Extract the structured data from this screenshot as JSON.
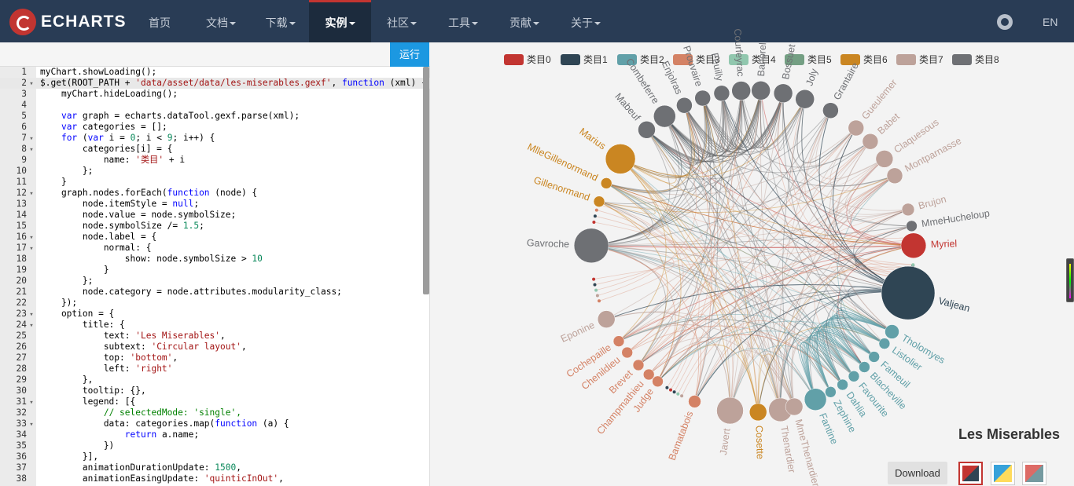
{
  "nav": {
    "logo_text": "ECHARTS",
    "items": [
      {
        "label": "首页",
        "caret": false
      },
      {
        "label": "文档",
        "caret": true
      },
      {
        "label": "下载",
        "caret": true
      },
      {
        "label": "实例",
        "caret": true,
        "active": true
      },
      {
        "label": "社区",
        "caret": true
      },
      {
        "label": "工具",
        "caret": true
      },
      {
        "label": "贡献",
        "caret": true
      },
      {
        "label": "关于",
        "caret": true
      }
    ],
    "lang": "EN"
  },
  "editor": {
    "run_label": "运行",
    "lines": [
      {
        "n": "1",
        "fold": "",
        "code": "myChart.showLoading();"
      },
      {
        "n": "2",
        "fold": "▾",
        "code": "$.get(ROOT_PATH + 'data/asset/data/les-miserables.gexf', function (xml) {"
      },
      {
        "n": "3",
        "fold": "",
        "code": "    myChart.hideLoading();"
      },
      {
        "n": "4",
        "fold": "",
        "code": ""
      },
      {
        "n": "5",
        "fold": "",
        "code": "    var graph = echarts.dataTool.gexf.parse(xml);"
      },
      {
        "n": "6",
        "fold": "",
        "code": "    var categories = [];"
      },
      {
        "n": "7",
        "fold": "▾",
        "code": "    for (var i = 0; i < 9; i++) {"
      },
      {
        "n": "8",
        "fold": "▾",
        "code": "        categories[i] = {"
      },
      {
        "n": "9",
        "fold": "",
        "code": "            name: '类目' + i"
      },
      {
        "n": "10",
        "fold": "",
        "code": "        };"
      },
      {
        "n": "11",
        "fold": "",
        "code": "    }"
      },
      {
        "n": "12",
        "fold": "▾",
        "code": "    graph.nodes.forEach(function (node) {"
      },
      {
        "n": "13",
        "fold": "",
        "code": "        node.itemStyle = null;"
      },
      {
        "n": "14",
        "fold": "",
        "code": "        node.value = node.symbolSize;"
      },
      {
        "n": "15",
        "fold": "",
        "code": "        node.symbolSize /= 1.5;"
      },
      {
        "n": "16",
        "fold": "▾",
        "code": "        node.label = {"
      },
      {
        "n": "17",
        "fold": "▾",
        "code": "            normal: {"
      },
      {
        "n": "18",
        "fold": "",
        "code": "                show: node.symbolSize > 10"
      },
      {
        "n": "19",
        "fold": "",
        "code": "            }"
      },
      {
        "n": "20",
        "fold": "",
        "code": "        };"
      },
      {
        "n": "21",
        "fold": "",
        "code": "        node.category = node.attributes.modularity_class;"
      },
      {
        "n": "22",
        "fold": "",
        "code": "    });"
      },
      {
        "n": "23",
        "fold": "▾",
        "code": "    option = {"
      },
      {
        "n": "24",
        "fold": "▾",
        "code": "        title: {"
      },
      {
        "n": "25",
        "fold": "",
        "code": "            text: 'Les Miserables',"
      },
      {
        "n": "26",
        "fold": "",
        "code": "            subtext: 'Circular layout',"
      },
      {
        "n": "27",
        "fold": "",
        "code": "            top: 'bottom',"
      },
      {
        "n": "28",
        "fold": "",
        "code": "            left: 'right'"
      },
      {
        "n": "29",
        "fold": "",
        "code": "        },"
      },
      {
        "n": "30",
        "fold": "",
        "code": "        tooltip: {},"
      },
      {
        "n": "31",
        "fold": "▾",
        "code": "        legend: [{"
      },
      {
        "n": "32",
        "fold": "",
        "code": "            // selectedMode: 'single',"
      },
      {
        "n": "33",
        "fold": "▾",
        "code": "            data: categories.map(function (a) {"
      },
      {
        "n": "34",
        "fold": "",
        "code": "                return a.name;"
      },
      {
        "n": "35",
        "fold": "",
        "code": "            })"
      },
      {
        "n": "36",
        "fold": "",
        "code": "        }],"
      },
      {
        "n": "37",
        "fold": "",
        "code": "        animationDurationUpdate: 1500,"
      },
      {
        "n": "38",
        "fold": "",
        "code": "        animationEasingUpdate: 'quinticInOut',"
      }
    ]
  },
  "chart": {
    "title": "Les Miserables",
    "download_label": "Download",
    "legend": [
      {
        "name": "类目0",
        "color": "#c23531"
      },
      {
        "name": "类目1",
        "color": "#2f4554"
      },
      {
        "name": "类目2",
        "color": "#61a0a8"
      },
      {
        "name": "类目3",
        "color": "#d48265"
      },
      {
        "name": "类目4",
        "color": "#91c7ae"
      },
      {
        "name": "类目5",
        "color": "#749f83"
      },
      {
        "name": "类目6",
        "color": "#ca8622"
      },
      {
        "name": "类目7",
        "color": "#bda29a"
      },
      {
        "name": "类目8",
        "color": "#6e7074"
      }
    ],
    "labeled_nodes": [
      {
        "name": "Myriel",
        "category": 0
      },
      {
        "name": "MmeHucheloup",
        "category": 8
      },
      {
        "name": "Brujon",
        "category": 7
      },
      {
        "name": "Montparnasse",
        "category": 7
      },
      {
        "name": "Claquesous",
        "category": 7
      },
      {
        "name": "Babet",
        "category": 7
      },
      {
        "name": "Gueulemer",
        "category": 7
      },
      {
        "name": "Grantaire",
        "category": 8
      },
      {
        "name": "Joly",
        "category": 8
      },
      {
        "name": "Bossuet",
        "category": 8
      },
      {
        "name": "Bahorel",
        "category": 8
      },
      {
        "name": "Courfeyrac",
        "category": 8
      },
      {
        "name": "Feuilly",
        "category": 8
      },
      {
        "name": "Prouvaire",
        "category": 8
      },
      {
        "name": "Enjolras",
        "category": 8
      },
      {
        "name": "Combeferre",
        "category": 8
      },
      {
        "name": "Mabeuf",
        "category": 8
      },
      {
        "name": "Marius",
        "category": 6
      },
      {
        "name": "MlleGillenormand",
        "category": 6
      },
      {
        "name": "Gillenormand",
        "category": 6
      },
      {
        "name": "Gavroche",
        "category": 8
      },
      {
        "name": "Eponine",
        "category": 7
      },
      {
        "name": "Cochepaille",
        "category": 3
      },
      {
        "name": "Chenildieu",
        "category": 3
      },
      {
        "name": "Brevet",
        "category": 3
      },
      {
        "name": "Champmathieu",
        "category": 3
      },
      {
        "name": "Judge",
        "category": 3
      },
      {
        "name": "Bamatabois",
        "category": 3
      },
      {
        "name": "Javert",
        "category": 7
      },
      {
        "name": "Cosette",
        "category": 6
      },
      {
        "name": "Thenardier",
        "category": 7
      },
      {
        "name": "MmeThenardier",
        "category": 7
      },
      {
        "name": "Fantine",
        "category": 2
      },
      {
        "name": "Zephine",
        "category": 2
      },
      {
        "name": "Dahlia",
        "category": 2
      },
      {
        "name": "Favourite",
        "category": 2
      },
      {
        "name": "Blacheville",
        "category": 2
      },
      {
        "name": "Fameuil",
        "category": 2
      },
      {
        "name": "Listolier",
        "category": 2
      },
      {
        "name": "Tholomyes",
        "category": 2
      },
      {
        "name": "Valjean",
        "category": 1
      }
    ]
  }
}
